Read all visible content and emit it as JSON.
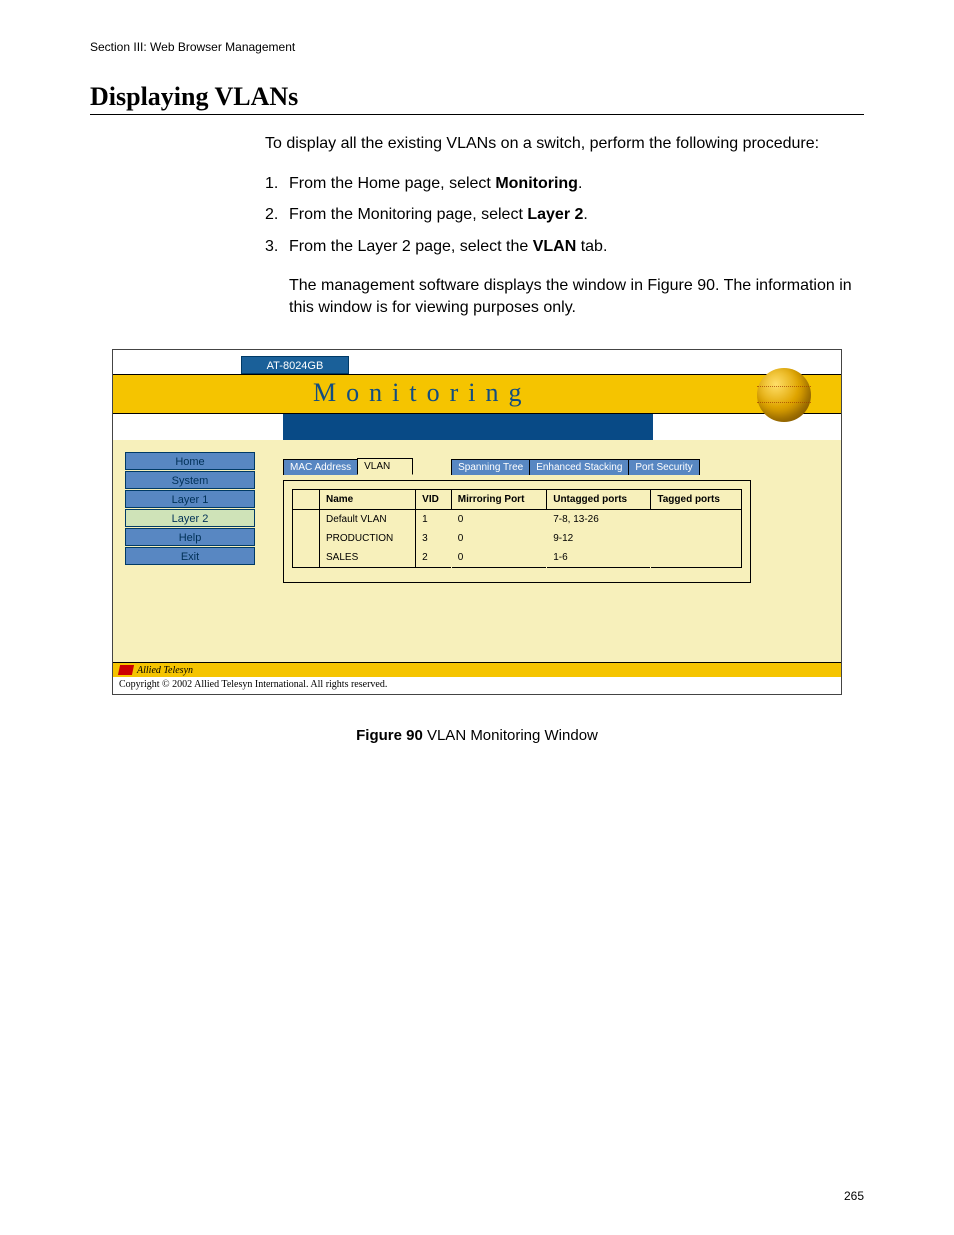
{
  "running_head": "Section III: Web Browser Management",
  "page_title": "Displaying VLANs",
  "intro": "To display all the existing VLANs on a switch, perform the following procedure:",
  "steps": [
    {
      "n": "1.",
      "pre": "From the Home page, select ",
      "bold": "Monitoring",
      "post": "."
    },
    {
      "n": "2.",
      "pre": "From the Monitoring page, select ",
      "bold": "Layer 2",
      "post": "."
    },
    {
      "n": "3.",
      "pre": "From the Layer 2 page, select the ",
      "bold": "VLAN",
      "post": " tab."
    }
  ],
  "step3_explain": "The management software displays the window in Figure 90. The information in this window is for viewing purposes only.",
  "figure": {
    "model_tab": "AT-8024GB",
    "header_title": "Monitoring",
    "sidebar": [
      "Home",
      "System",
      "Layer 1",
      "Layer 2",
      "Help",
      "Exit"
    ],
    "sidebar_active_index": 3,
    "tabs": [
      "MAC Address",
      "VLAN",
      "Spanning Tree",
      "Enhanced Stacking",
      "Port Security"
    ],
    "tabs_selected_index": 1,
    "columns": [
      "",
      "Name",
      "VID",
      "Mirroring Port",
      "Untagged ports",
      "Tagged ports"
    ],
    "rows": [
      {
        "name": "Default VLAN",
        "vid": "1",
        "mirror": "0",
        "untagged": "7-8, 13-26",
        "tagged": ""
      },
      {
        "name": "PRODUCTION",
        "vid": "3",
        "mirror": "0",
        "untagged": "9-12",
        "tagged": ""
      },
      {
        "name": "SALES",
        "vid": "2",
        "mirror": "0",
        "untagged": "1-6",
        "tagged": ""
      }
    ],
    "footer_brand": "Allied Telesyn",
    "copyright": "Copyright © 2002 Allied Telesyn International. All rights reserved."
  },
  "figcaption": {
    "label": "Figure 90",
    "text": "  VLAN Monitoring Window"
  },
  "page_number": "265"
}
